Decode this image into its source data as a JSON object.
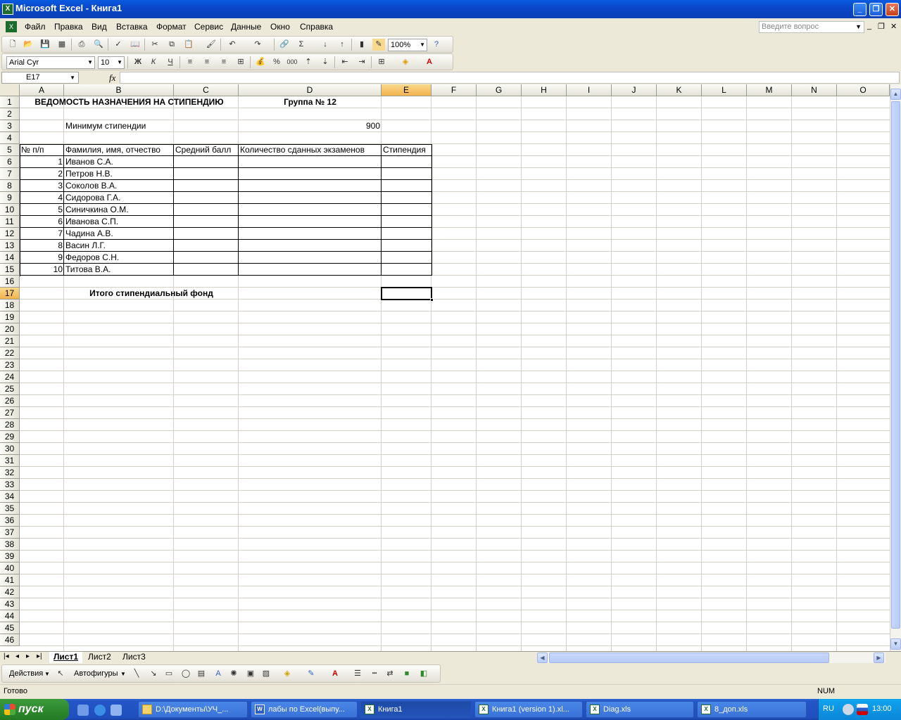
{
  "window": {
    "title": "Microsoft Excel - Книга1"
  },
  "menu": {
    "items": [
      "Файл",
      "Правка",
      "Вид",
      "Вставка",
      "Формат",
      "Сервис",
      "Данные",
      "Окно",
      "Справка"
    ],
    "help_placeholder": "Введите вопрос"
  },
  "toolbar": {
    "zoom": "100%",
    "font_name": "Arial Cyr",
    "font_size": "10",
    "bold_label": "Ж",
    "italic_label": "К",
    "underline_label": "Ч",
    "percent_label": "%",
    "thousands_label": "000"
  },
  "formula_bar": {
    "name_box": "E17",
    "fx": "fx",
    "formula": ""
  },
  "columns": [
    "A",
    "B",
    "C",
    "D",
    "E",
    "F",
    "G",
    "H",
    "I",
    "J",
    "K",
    "L",
    "M",
    "N",
    "O"
  ],
  "active_cell": {
    "column": "E",
    "row": "17"
  },
  "rows": [
    "1",
    "2",
    "3",
    "4",
    "5",
    "6",
    "7",
    "8",
    "9",
    "10",
    "11",
    "12",
    "13",
    "14",
    "15",
    "16",
    "17",
    "18",
    "19",
    "20",
    "21",
    "22",
    "23",
    "24",
    "25",
    "26",
    "27",
    "28",
    "29",
    "30",
    "31",
    "32",
    "33",
    "34",
    "35",
    "36",
    "37",
    "38",
    "39",
    "40",
    "41",
    "42",
    "43",
    "44",
    "45",
    "46"
  ],
  "sheet": {
    "title": "ВЕДОМОСТЬ НАЗНАЧЕНИЯ НА СТИПЕНДИЮ",
    "group": "Группа № 12",
    "min_label": "Минимум стипендии",
    "min_value": "900",
    "headers": [
      "№ п/п",
      "Фамилия, имя, отчество",
      "Средний балл",
      "Количество сданных экзаменов",
      "Стипендия"
    ],
    "students": [
      {
        "num": "1",
        "name": "Иванов С.А."
      },
      {
        "num": "2",
        "name": "Петров Н.В."
      },
      {
        "num": "3",
        "name": "Соколов В.А."
      },
      {
        "num": "4",
        "name": "Сидорова Г.А."
      },
      {
        "num": "5",
        "name": "Синичкина О.М."
      },
      {
        "num": "6",
        "name": "Иванова С.П."
      },
      {
        "num": "7",
        "name": "Чадина А.В."
      },
      {
        "num": "8",
        "name": "Васин Л.Г."
      },
      {
        "num": "9",
        "name": "Федоров С.Н."
      },
      {
        "num": "10",
        "name": "Титова В.А."
      }
    ],
    "total_label": "Итого стипендиальный фонд"
  },
  "tabs": [
    "Лист1",
    "Лист2",
    "Лист3"
  ],
  "drawing": {
    "actions": "Действия",
    "autoshapes": "Автофигуры"
  },
  "status": {
    "ready": "Готово",
    "num": "NUM"
  },
  "taskbar": {
    "start": "пуск",
    "tasks": [
      "D:\\Документы\\УЧ_...",
      "лабы по Excel(выпу...",
      "Книга1",
      "Книга1 (version 1).xl...",
      "Diag.xls",
      "8_доп.xls"
    ],
    "lang": "RU",
    "clock": "13:00"
  },
  "colors": {
    "title_blue": "#0a47c8",
    "active_header": "#f2b24d",
    "taskbar_blue": "#2456c7",
    "start_green": "#2f8a2f"
  }
}
